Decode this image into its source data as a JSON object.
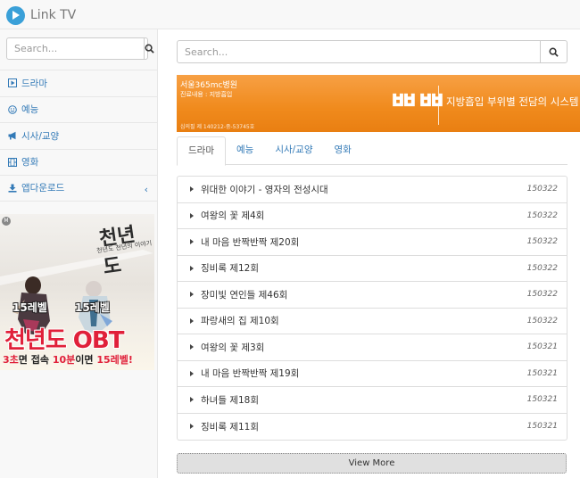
{
  "app": {
    "title": "Link TV"
  },
  "sidebar": {
    "search_placeholder": "Search...",
    "items": [
      {
        "label": "드라마",
        "icon": "play-square-icon"
      },
      {
        "label": "예능",
        "icon": "smile-icon"
      },
      {
        "label": "시사/교양",
        "icon": "bullhorn-icon"
      },
      {
        "label": "영화",
        "icon": "film-icon"
      },
      {
        "label": "앱다운로드",
        "icon": "download-icon"
      }
    ],
    "ad": {
      "logo": "천년도",
      "logo_sub": "천년도 천년의 이야기",
      "level1": "15레벨",
      "level2": "15레벨",
      "headline": "천년도 OBT",
      "tag_a": "3초",
      "tag_b": "면 접속 ",
      "tag_c": "10분",
      "tag_d": "이면 ",
      "tag_e": "15레벨!"
    }
  },
  "main": {
    "search_placeholder": "Search...",
    "ad": {
      "name": "서울365mc병원",
      "sub": "진료내용 : 지방흡입",
      "reg": "심의필 제 140212-중-53745호",
      "big": "ᄈᄈ",
      "copy": "지방흡입 부위별 전담의 시스템"
    },
    "tabs": [
      {
        "label": "드라마",
        "active": true
      },
      {
        "label": "예능"
      },
      {
        "label": "시사/교양"
      },
      {
        "label": "영화"
      }
    ],
    "list": [
      {
        "title": "위대한 이야기 - 영자의 전성시대",
        "date": "150322"
      },
      {
        "title": "여왕의 꽃 제4회",
        "date": "150322"
      },
      {
        "title": "내 마음 반짝반짝 제20회",
        "date": "150322"
      },
      {
        "title": "징비록 제12회",
        "date": "150322"
      },
      {
        "title": "장미빛 연인들 제46회",
        "date": "150322"
      },
      {
        "title": "파랑새의 집 제10회",
        "date": "150322"
      },
      {
        "title": "여왕의 꽃 제3회",
        "date": "150321"
      },
      {
        "title": "내 마음 반짝반짝 제19회",
        "date": "150321"
      },
      {
        "title": "하녀들 제18회",
        "date": "150321"
      },
      {
        "title": "징비록 제11회",
        "date": "150321"
      }
    ],
    "more_label": "View More"
  },
  "colors": {
    "link": "#337ab7",
    "brand": "#3aa0d8",
    "ad_orange": "#f08a1c"
  }
}
